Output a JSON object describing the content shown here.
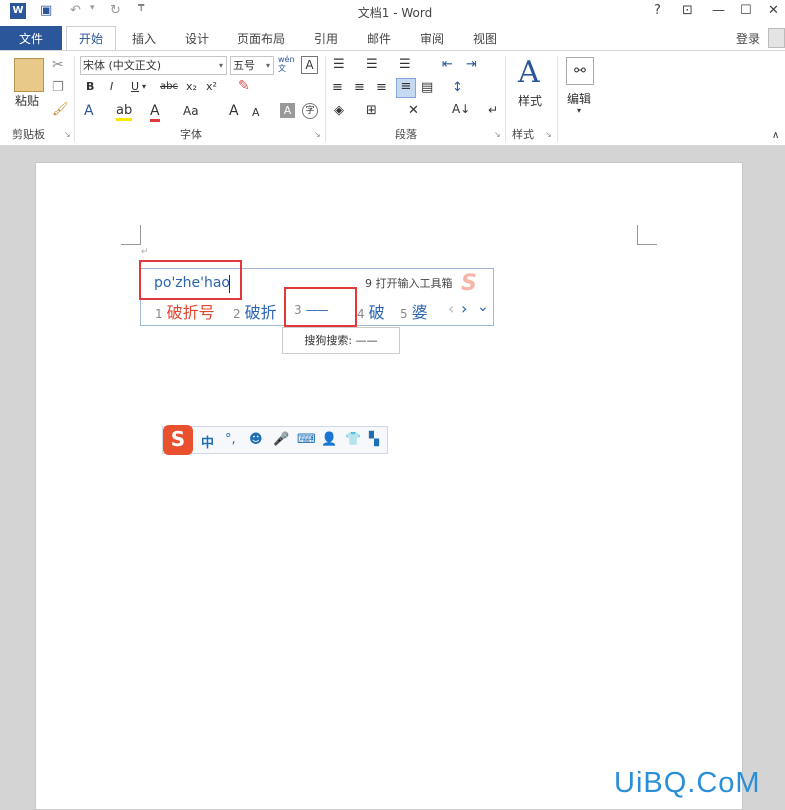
{
  "titlebar": {
    "title": "文档1 - Word",
    "help": "?",
    "ribbon_opts": "⊡",
    "minimize": "—",
    "maximize": "☐",
    "close": "✕",
    "app_icon": "word-icon",
    "save_icon": "save-icon",
    "undo_icon": "undo-icon",
    "redo_icon": "redo-icon",
    "customize": "₸"
  },
  "tabs": {
    "file": "文件",
    "home": "开始",
    "insert": "插入",
    "design": "设计",
    "layout": "页面布局",
    "references": "引用",
    "mailings": "邮件",
    "review": "审阅",
    "view": "视图",
    "login": "登录"
  },
  "ribbon": {
    "paste_label": "粘贴",
    "font_name": "宋体 (中文正文)",
    "font_size": "五号",
    "wen_label": "wén\n文",
    "groups": {
      "clipboard": "剪贴板",
      "font": "字体",
      "paragraph": "段落",
      "styles": "样式"
    },
    "styles_label": "样式",
    "edit_label": "编辑",
    "bold": "B",
    "italic": "I",
    "underline": "U",
    "strike": "abc",
    "subscript": "x₂",
    "superscript": "x²",
    "font_a": "A",
    "grow": "A",
    "shrink": "A",
    "case": "Aa",
    "clear": "A",
    "enclose": "字"
  },
  "ime": {
    "composition": "po'zhe'hao",
    "toolbox": "9 打开输入工具箱",
    "candidates": [
      {
        "num": "1",
        "text": "破折号"
      },
      {
        "num": "2",
        "text": "破折"
      },
      {
        "num": "3",
        "text": "——"
      },
      {
        "num": "4",
        "text": "破"
      },
      {
        "num": "5",
        "text": "婆"
      }
    ],
    "prev": "‹",
    "next": "›",
    "expand": "⌄",
    "search_popup": "搜狗搜索: ——"
  },
  "statusbar": {
    "lang": "中",
    "punct": "°,",
    "emoji_icon": "emoji-icon",
    "mic_icon": "mic-icon",
    "keyboard_icon": "keyboard-icon",
    "user_icon": "user-icon",
    "skin_icon": "shirt-icon",
    "apps_icon": "apps-icon"
  },
  "watermark": "UiBQ.CoM",
  "colors": {
    "word_blue": "#2b579a",
    "ime_blue": "#2a64b2",
    "highlight_red": "#e0383b",
    "sogou_orange": "#e8502e"
  }
}
